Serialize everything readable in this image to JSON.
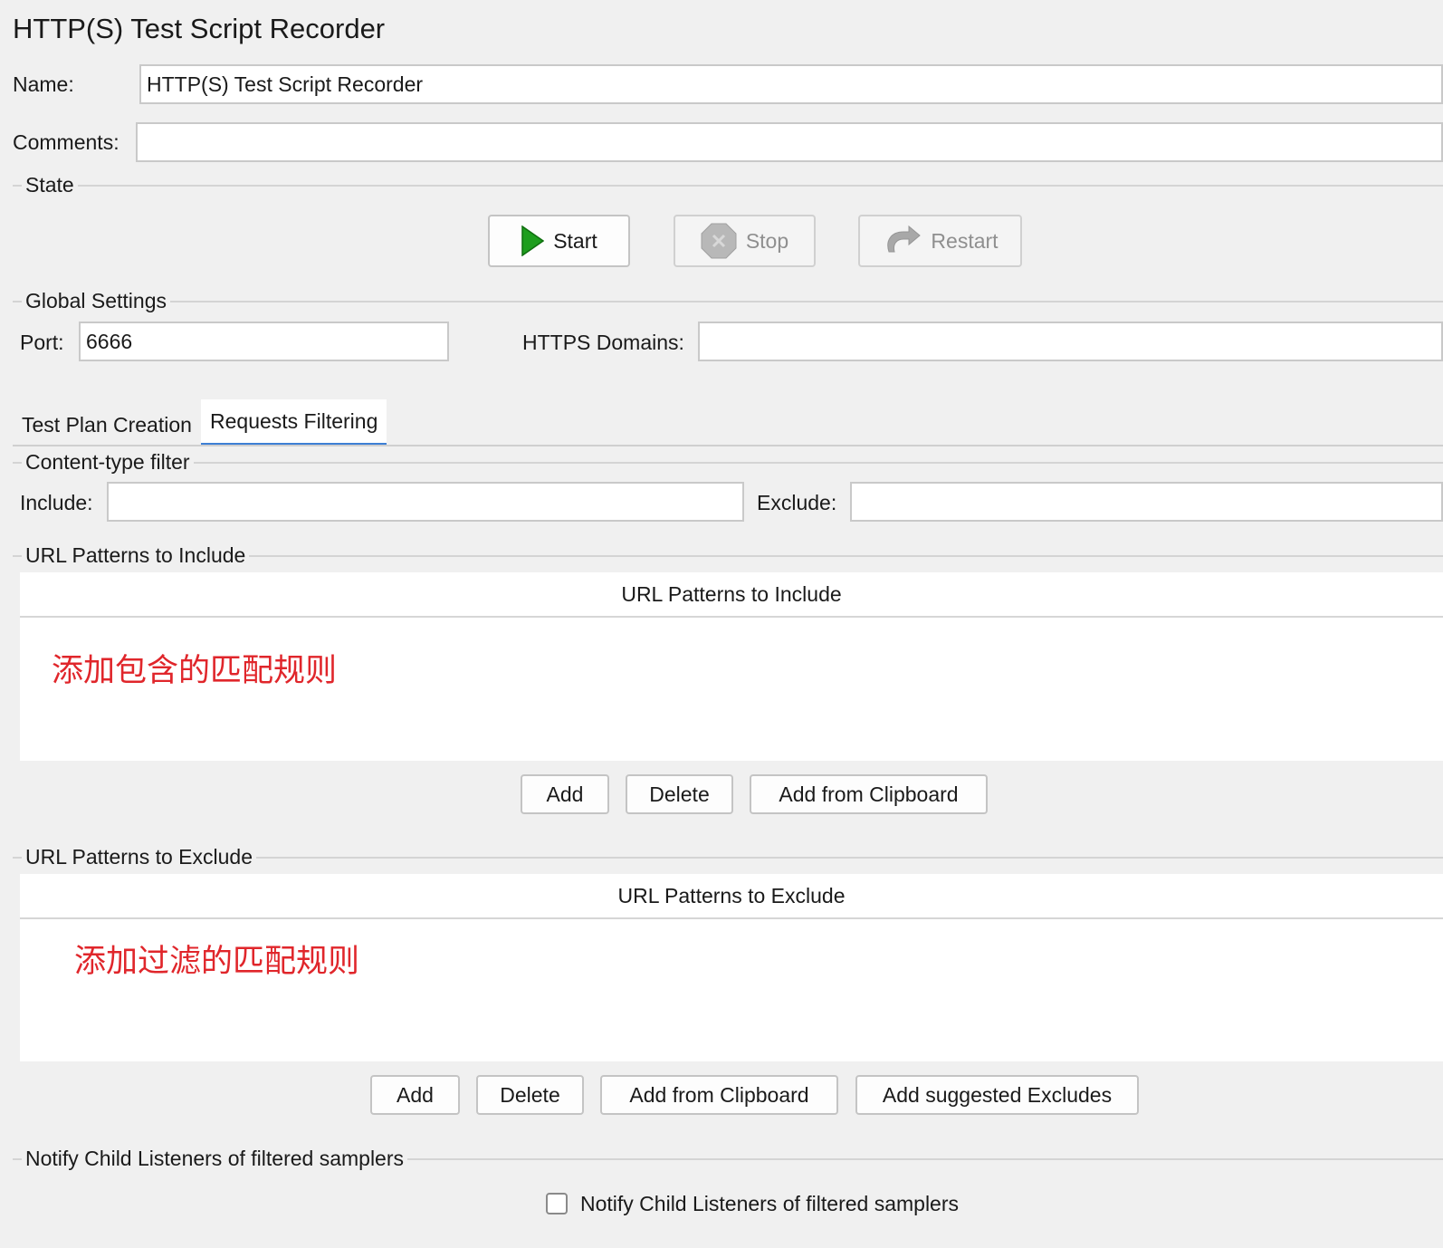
{
  "window": {
    "title": "HTTP(S) Test Script Recorder"
  },
  "form": {
    "name_label": "Name:",
    "name_value": "HTTP(S) Test Script Recorder",
    "comments_label": "Comments:",
    "comments_value": ""
  },
  "state": {
    "section_title": "State",
    "start_label": "Start",
    "stop_label": "Stop",
    "restart_label": "Restart"
  },
  "global_settings": {
    "section_title": "Global Settings",
    "port_label": "Port:",
    "port_value": "6666",
    "https_domains_label": "HTTPS Domains:",
    "https_domains_value": ""
  },
  "tabs": [
    {
      "label": "Test Plan Creation",
      "active": false
    },
    {
      "label": "Requests Filtering",
      "active": true
    }
  ],
  "content_type_filter": {
    "section_title": "Content-type filter",
    "include_label": "Include:",
    "include_value": "",
    "exclude_label": "Exclude:",
    "exclude_value": ""
  },
  "include_patterns": {
    "section_title": "URL Patterns to Include",
    "column_header": "URL Patterns to Include",
    "annotation": "添加包含的匹配规则",
    "add_label": "Add",
    "delete_label": "Delete",
    "add_clipboard_label": "Add from Clipboard"
  },
  "exclude_patterns": {
    "section_title": "URL Patterns to Exclude",
    "column_header": "URL Patterns to Exclude",
    "annotation": "添加过滤的匹配规则",
    "add_label": "Add",
    "delete_label": "Delete",
    "add_clipboard_label": "Add from Clipboard",
    "add_suggested_label": "Add suggested Excludes"
  },
  "notify": {
    "section_title": "Notify Child Listeners of filtered samplers",
    "checkbox_label": "Notify Child Listeners of filtered samplers",
    "checked": false
  },
  "colors": {
    "background": "#f0f0f0",
    "annotation_red": "#e0262b",
    "tab_underline": "#3d7fd4",
    "start_icon_green": "#1e9e1e"
  }
}
